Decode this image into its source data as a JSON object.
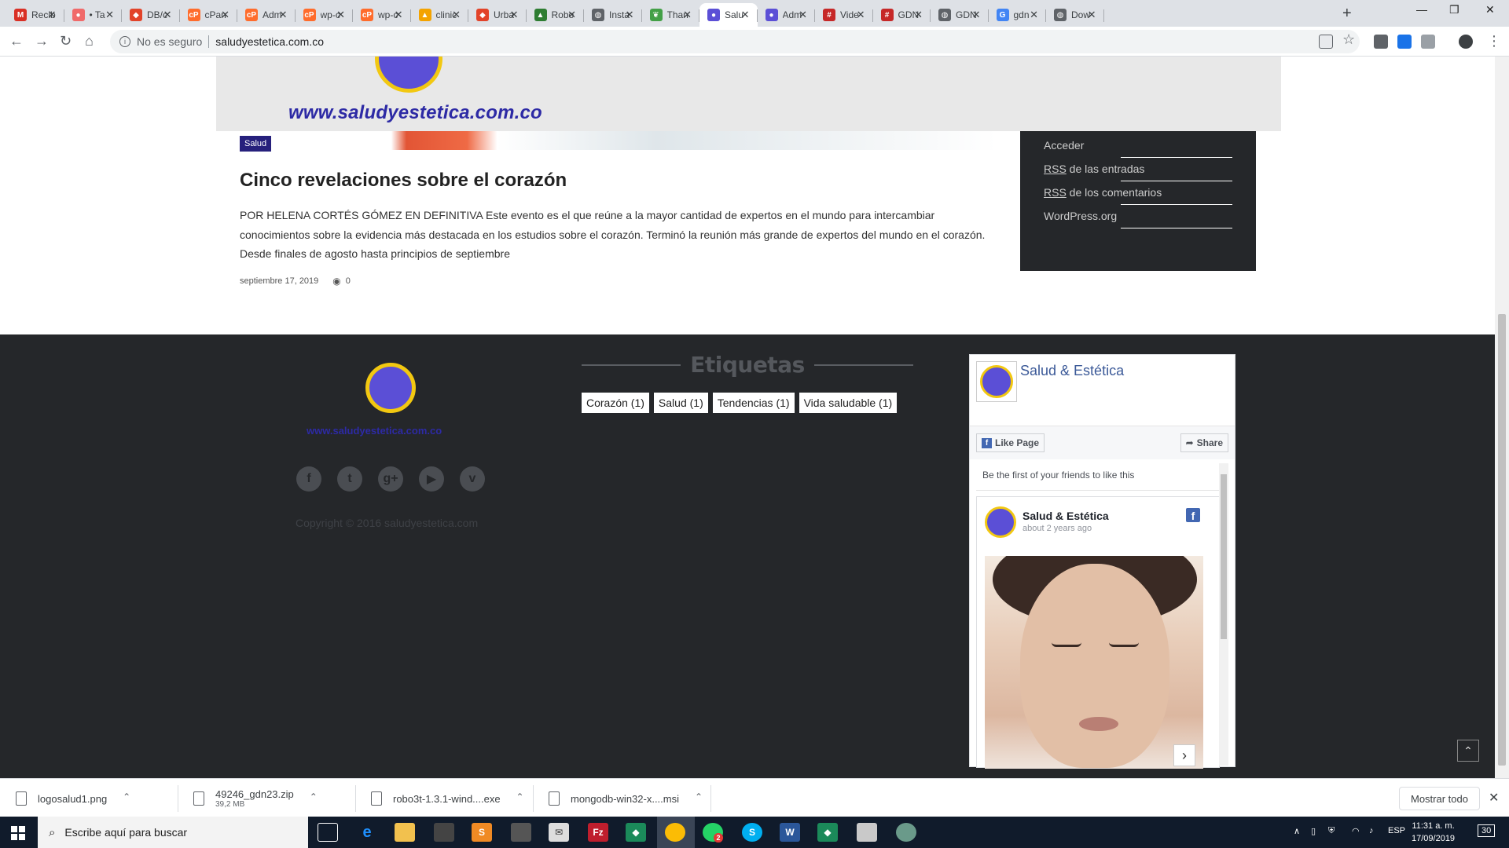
{
  "browser": {
    "tabs": [
      {
        "label": "Recib",
        "icon": "gmail-icon",
        "color": "#d93025",
        "glyph": "M"
      },
      {
        "label": "• Ta",
        "icon": "asana-icon",
        "color": "#f06a6a",
        "glyph": "●"
      },
      {
        "label": "DB/c",
        "icon": "gitlab-icon",
        "color": "#e24329",
        "glyph": "◆"
      },
      {
        "label": "cPan",
        "icon": "cpanel-icon",
        "color": "#ff6c2c",
        "glyph": "cP"
      },
      {
        "label": "Adm",
        "icon": "cpanel-icon",
        "color": "#ff6c2c",
        "glyph": "cP"
      },
      {
        "label": "wp-c",
        "icon": "cpanel-icon",
        "color": "#ff6c2c",
        "glyph": "cP"
      },
      {
        "label": "wp-c",
        "icon": "cpanel-icon",
        "color": "#ff6c2c",
        "glyph": "cP"
      },
      {
        "label": "clinic",
        "icon": "chart-icon",
        "color": "#f4a300",
        "glyph": "▲"
      },
      {
        "label": "Urba",
        "icon": "gitlab-icon",
        "color": "#e24329",
        "glyph": "◆"
      },
      {
        "label": "Robo",
        "icon": "robo-icon",
        "color": "#2e7d32",
        "glyph": "▲"
      },
      {
        "label": "Insta",
        "icon": "globe-icon",
        "color": "#5f6368",
        "glyph": "◍"
      },
      {
        "label": "Than",
        "icon": "leaf-icon",
        "color": "#43a047",
        "glyph": "❦"
      },
      {
        "label": "Salu",
        "icon": "salud-logo-icon",
        "color": "#5b4fd6",
        "glyph": "●"
      },
      {
        "label": "Adm",
        "icon": "salud-logo-icon",
        "color": "#5b4fd6",
        "glyph": "●"
      },
      {
        "label": "Vide",
        "icon": "hashtag-icon",
        "color": "#c62828",
        "glyph": "#"
      },
      {
        "label": "GDN",
        "icon": "hashtag-icon",
        "color": "#c62828",
        "glyph": "#"
      },
      {
        "label": "GDN",
        "icon": "globe-icon",
        "color": "#5f6368",
        "glyph": "◍"
      },
      {
        "label": "gdn",
        "icon": "google-icon",
        "color": "#4285f4",
        "glyph": "G"
      },
      {
        "label": "Dow",
        "icon": "globe-icon",
        "color": "#5f6368",
        "glyph": "◍"
      }
    ],
    "active_tab_index": 12,
    "address": {
      "security": "No es seguro",
      "url": "saludyestetica.com.co"
    }
  },
  "site": {
    "logo_url": "www.saludyestetica.com.co",
    "article": {
      "category": "Salud",
      "title": "Cinco revelaciones sobre el corazón",
      "excerpt": "POR HELENA CORTÉS GÓMEZ EN DEFINITIVA Este evento es el que reúne a la mayor cantidad de expertos en el mundo para intercambiar conocimientos sobre la evidencia más destacada en los estudios sobre el corazón. Terminó la reunión más grande de expertos del mundo en el corazón. Desde finales de agosto hasta principios de septiembre",
      "date": "septiembre 17, 2019",
      "views": "0"
    },
    "sidebar_meta": [
      {
        "abbr": "",
        "label": "Acceder"
      },
      {
        "abbr": "RSS",
        "label": " de las entradas"
      },
      {
        "abbr": "RSS",
        "label": " de los comentarios"
      },
      {
        "abbr": "",
        "label": "WordPress.org"
      }
    ],
    "footer": {
      "logo_url": "www.saludyestetica.com.co",
      "socials": [
        {
          "name": "facebook-icon",
          "glyph": "f"
        },
        {
          "name": "twitter-icon",
          "glyph": "t"
        },
        {
          "name": "google-plus-icon",
          "glyph": "g+"
        },
        {
          "name": "youtube-icon",
          "glyph": "▶"
        },
        {
          "name": "vimeo-icon",
          "glyph": "v"
        }
      ],
      "copyright": "Copyright © 2016 saludyestetica.com",
      "tags_title": "Etiquetas",
      "tags": [
        "Corazón (1)",
        "Salud (1)",
        "Tendencias (1)",
        "Vida saludable (1)"
      ]
    },
    "facebook": {
      "page_name": "Salud & Estética",
      "like_label": "Like Page",
      "share_label": "Share",
      "friends_text": "Be the first of your friends to like this",
      "post_author": "Salud & Estética",
      "post_time": "about 2 years ago"
    }
  },
  "downloads": {
    "items": [
      {
        "name": "logosalud1.png",
        "size": ""
      },
      {
        "name": "49246_gdn23.zip",
        "size": "39,2 MB"
      },
      {
        "name": "robo3t-1.3.1-wind....exe",
        "size": ""
      },
      {
        "name": "mongodb-win32-x....msi",
        "size": ""
      }
    ],
    "show_all": "Mostrar todo"
  },
  "taskbar": {
    "search_placeholder": "Escribe aquí para buscar",
    "language": "ESP",
    "time": "11:31 a. m.",
    "date": "17/09/2019",
    "notifications": "30",
    "whatsapp_badge": "2"
  }
}
